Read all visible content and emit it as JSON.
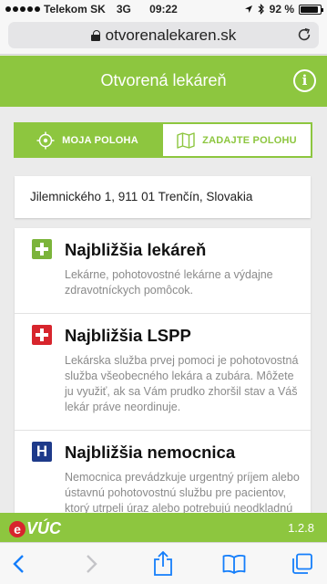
{
  "statusbar": {
    "carrier": "Telekom SK",
    "network": "3G",
    "time": "09:22",
    "battery": "92 %",
    "battery_level": 0.92
  },
  "browser": {
    "url": "otvorenalekaren.sk"
  },
  "header": {
    "title": "Otvorená lekáreň",
    "info_icon": "info-icon"
  },
  "tabs": [
    {
      "label": "MOJA POLOHA",
      "icon": "crosshair-icon",
      "active": true
    },
    {
      "label": "ZADAJTE POLOHU",
      "icon": "map-icon",
      "active": false
    }
  ],
  "location": {
    "address": "Jilemnického 1, 911 01 Trenčín, Slovakia"
  },
  "cards": [
    {
      "title": "Najbližšia lekáreň",
      "description": "Lekárne, pohotovostné lekárne a výdajne zdravotníckych pomôcok.",
      "icon": "green-cross-icon",
      "color": "#7bb43a"
    },
    {
      "title": "Najbližšia LSPP",
      "description": "Lekárska služba prvej pomoci je pohotovostná služba všeobecného lekára a zubára. Môžete ju využiť, ak sa Vám prudko zhoršil stav a Váš lekár práve neordinuje.",
      "icon": "red-cross-icon",
      "color": "#d7252d"
    },
    {
      "title": "Najbližšia nemocnica",
      "description": "Nemocnica prevádzkuje urgentný príjem alebo ústavnú pohotovostnú službu pre pacientov, ktorý utrpeli úraz alebo potrebujú neodkladnú zdravotnú",
      "icon": "hospital-h-icon",
      "badge_letter": "H",
      "color": "#1e3a8a"
    }
  ],
  "footer": {
    "logo_e": "e",
    "logo_text": "VÚC",
    "version": "1.2.8"
  },
  "colors": {
    "brand_green": "#8dc63f",
    "red": "#d7252d",
    "ios_blue": "#147efb"
  }
}
